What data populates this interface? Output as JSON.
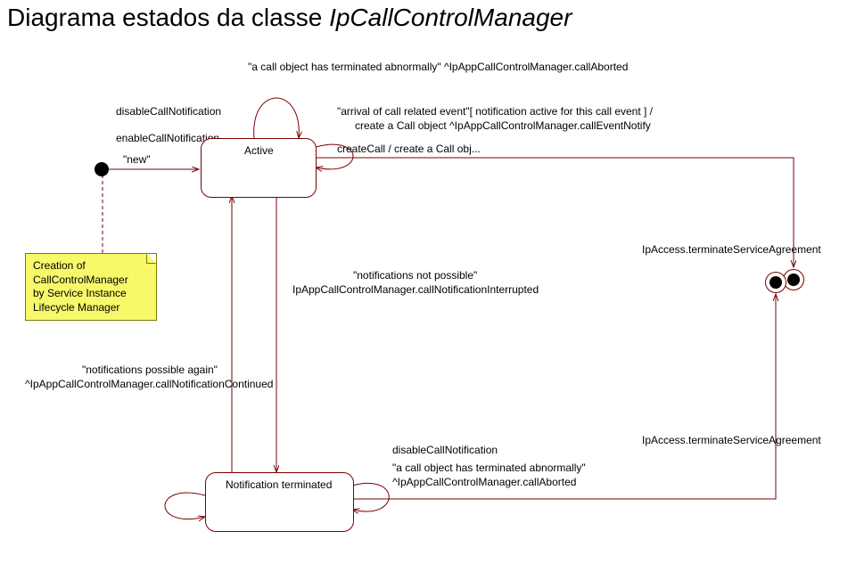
{
  "title_prefix": "Diagrama estados da classe ",
  "title_italic": "IpCallControlManager",
  "labels": {
    "callAborted": "\"a call object has terminated abnormally\" ^IpAppCallControlManager.callAborted",
    "disableCallNotification": "disableCallNotification",
    "enableCallNotification": "enableCallNotification",
    "new": "\"new\"",
    "active": "Active",
    "arrival1": "\"arrival of call related event\"[ notification active for this call event ] /",
    "arrival2": "create a Call object ^IpAppCallControlManager.callEventNotify",
    "createCall": "createCall / create a Call obj...",
    "note1": "Creation of",
    "note2": "CallControlManager",
    "note3": "by Service Instance",
    "note4": "Lifecycle Manager",
    "notifNotPossible1": "\"notifications not possible\"",
    "notifNotPossible2": "IpAppCallControlManager.callNotificationInterrupted",
    "terminateSA": "IpAccess.terminateServiceAgreement",
    "notifPossible1": "\"notifications possible again\"",
    "notifPossible2": "^IpAppCallControlManager.callNotificationContinued",
    "disableCallNotification2": "disableCallNotification",
    "callAborted2a": "\"a call object has terminated abnormally\"",
    "callAborted2b": "^IpAppCallControlManager.callAborted",
    "notificationTerminated": "Notification terminated",
    "terminateSA2": "IpAccess.terminateServiceAgreement"
  }
}
